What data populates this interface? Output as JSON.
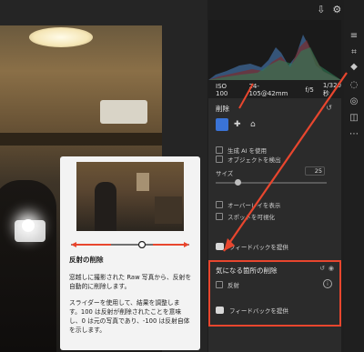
{
  "exif": {
    "iso": "ISO 100",
    "lens": "24-105@42mm",
    "aperture": "f/5",
    "shutter": "1/320 秒"
  },
  "remove_panel": {
    "title": "削除",
    "use_ai": "生成 AI を使用",
    "detect_objects": "オブジェクトを検出",
    "size_label": "サイズ",
    "size_value": "25",
    "size_fraction": 0.2,
    "overlay": "オーバーレイを表示",
    "visualize_spots": "スポットを可視化",
    "feedback": "フィードバックを提供"
  },
  "distraction_panel": {
    "title": "気になる箇所の削除",
    "reflection": "反射",
    "feedback": "フィードバックを提供"
  },
  "tooltip": {
    "title": "反射の削除",
    "body1": "窓越しに撮影された Raw 写真から、反射を",
    "body2": "自動的に削除します。",
    "body3": "スライダーを使用して、結果を調整しま",
    "body4": "す。100 は反射が削除されたことを意味",
    "body5": "し、0 は元の写真であり、-100 は反射自体",
    "body6": "を示します。",
    "slider_fraction": 0.6
  },
  "accent": "#e8462e",
  "icons": {
    "top": [
      "export-icon",
      "gear-icon",
      "expand-icon"
    ],
    "tools": [
      "sliders-icon",
      "crop-icon",
      "eraser-icon",
      "mask-icon",
      "redeye-icon",
      "presets-icon",
      "more-icon"
    ]
  }
}
